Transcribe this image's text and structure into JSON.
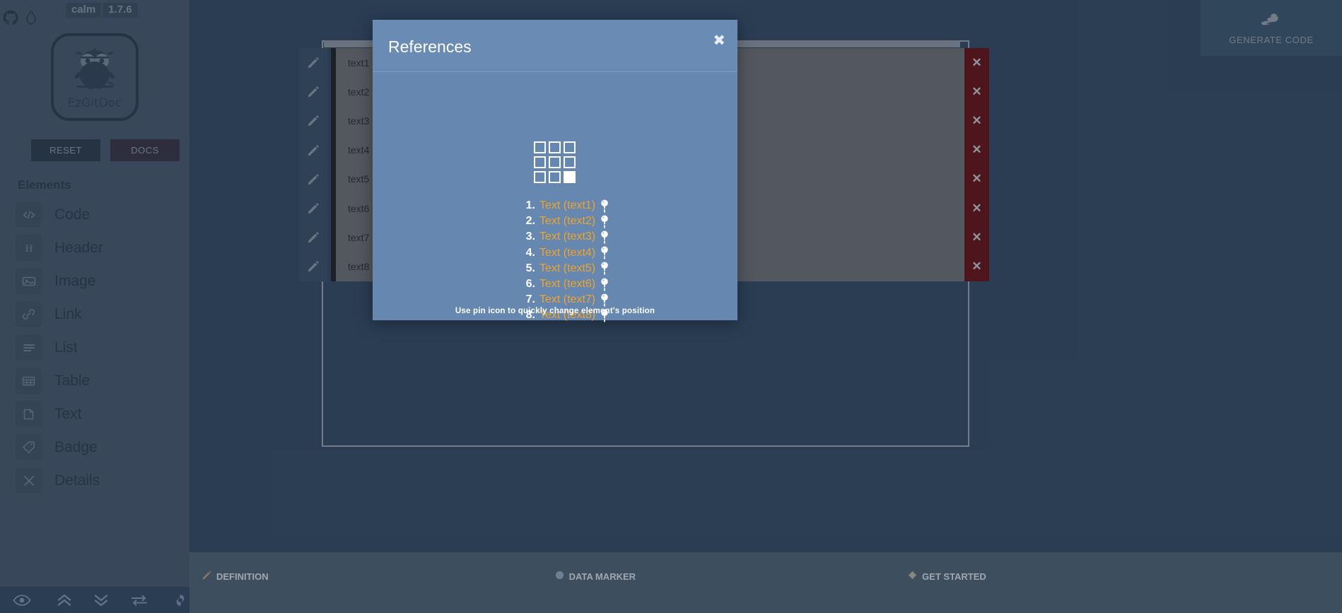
{
  "sidebar": {
    "top_icons": [
      {
        "name": "github-icon"
      },
      {
        "name": "droplet-icon"
      }
    ],
    "badges": [
      {
        "name": "status-badge",
        "label": "calm"
      },
      {
        "name": "version-badge",
        "label": "1.7.6"
      }
    ],
    "logo": {
      "name": "ezgitdoc-logo",
      "label": "EzGitDoc",
      "icon": "owl-icon"
    },
    "buttons": {
      "reset_label": "RESET",
      "docs_label": "DOCS"
    },
    "elements_title": "Elements",
    "items": [
      {
        "label": "Code",
        "icon": "code-icon"
      },
      {
        "label": "Header",
        "icon": "header-icon"
      },
      {
        "label": "Image",
        "icon": "image-icon"
      },
      {
        "label": "Link",
        "icon": "link-icon"
      },
      {
        "label": "List",
        "icon": "list-icon"
      },
      {
        "label": "Table",
        "icon": "table-icon"
      },
      {
        "label": "Text",
        "icon": "text-icon"
      },
      {
        "label": "Badge",
        "icon": "badge-icon"
      },
      {
        "label": "Details",
        "icon": "details-icon"
      }
    ],
    "toolbar": [
      {
        "name": "preview-eye-icon"
      },
      {
        "name": "chevrons-up-icon"
      },
      {
        "name": "chevrons-down-icon"
      },
      {
        "name": "swap-icon"
      },
      {
        "name": "gear-icon"
      }
    ]
  },
  "header": {
    "generate_code_label": "GENERATE CODE",
    "generate_code_icon": "snake-icon"
  },
  "editor": {
    "rows": [
      {
        "label": "text1",
        "edit_icon": "pencil-icon",
        "delete_icon": "close-icon"
      },
      {
        "label": "text2",
        "edit_icon": "pencil-icon",
        "delete_icon": "close-icon"
      },
      {
        "label": "text3",
        "edit_icon": "pencil-icon",
        "delete_icon": "close-icon"
      },
      {
        "label": "text4",
        "edit_icon": "pencil-icon",
        "delete_icon": "close-icon"
      },
      {
        "label": "text5",
        "edit_icon": "pencil-icon",
        "delete_icon": "close-icon"
      },
      {
        "label": "text6",
        "edit_icon": "pencil-icon",
        "delete_icon": "close-icon"
      },
      {
        "label": "text7",
        "edit_icon": "pencil-icon",
        "delete_icon": "close-icon"
      },
      {
        "label": "text8",
        "edit_icon": "pencil-icon",
        "delete_icon": "close-icon"
      }
    ],
    "delete_glyph": "✕"
  },
  "footer": {
    "items": [
      {
        "label": "DEFINITION",
        "icon": "pencil-icon"
      },
      {
        "label": "DATA MARKER",
        "icon": "circle-icon"
      },
      {
        "label": "GET STARTED",
        "icon": "diamond-icon"
      }
    ]
  },
  "modal": {
    "title": "References",
    "close_glyph": "✖",
    "hint": "Use pin icon to quickly change element's position",
    "grid": {
      "name": "position-grid",
      "rows": 3,
      "cols": 3,
      "active_index": 8
    },
    "references": [
      {
        "num": "1.",
        "label": "Text (text1)",
        "pin_icon": "pin-icon"
      },
      {
        "num": "2.",
        "label": "Text (text2)",
        "pin_icon": "pin-icon"
      },
      {
        "num": "3.",
        "label": "Text (text3)",
        "pin_icon": "pin-icon"
      },
      {
        "num": "4.",
        "label": "Text (text4)",
        "pin_icon": "pin-icon"
      },
      {
        "num": "5.",
        "label": "Text (text5)",
        "pin_icon": "pin-icon"
      },
      {
        "num": "6.",
        "label": "Text (text6)",
        "pin_icon": "pin-icon"
      },
      {
        "num": "7.",
        "label": "Text (text7)",
        "pin_icon": "pin-icon"
      },
      {
        "num": "8.",
        "label": "Text (text8)",
        "pin_icon": "pin-icon"
      }
    ]
  },
  "colors": {
    "sidebar_bg": "#5a6b7d",
    "canvas_bg": "#334a63",
    "modal_bg": "#6688b0",
    "modal_header_bg": "#6a8cb4",
    "accent_orange": "#f0a32a",
    "delete_red": "#6d0b0b",
    "docs_purple": "#3f2b3a",
    "reset_dark": "#2e3a47",
    "row_gray": "#757575"
  }
}
